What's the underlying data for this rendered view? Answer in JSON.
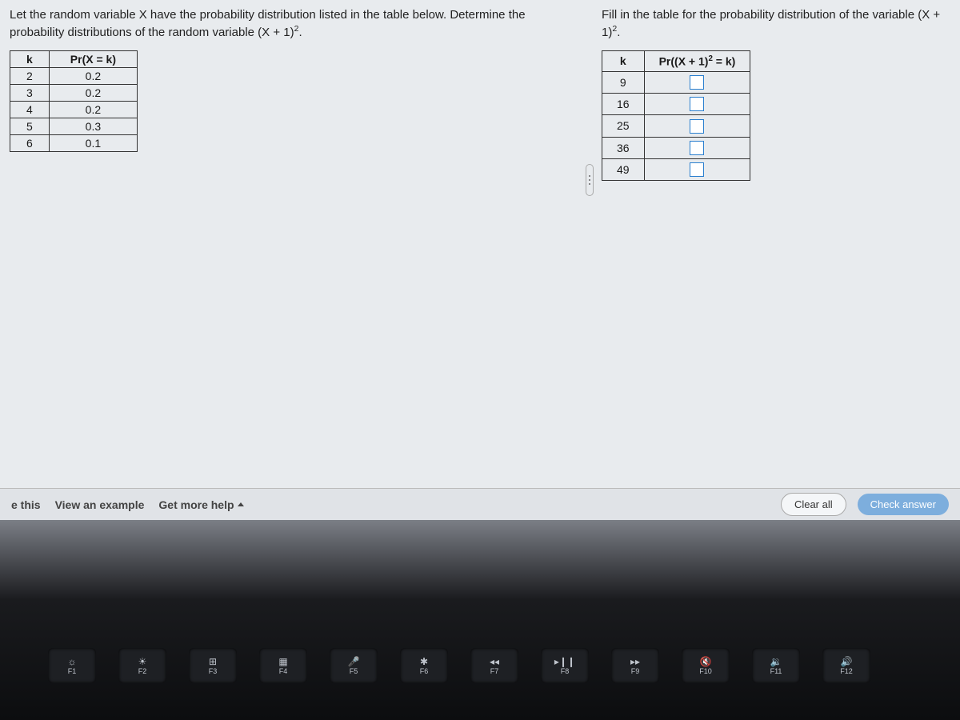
{
  "left": {
    "prompt_line1": "Let the random variable X have the probability distribution listed in the table below. Determine the",
    "prompt_line2_a": "probability distributions of the random variable (X + 1)",
    "prompt_line2_exp": "2",
    "prompt_line2_b": ".",
    "table": {
      "head_k": "k",
      "head_p": "Pr(X = k)",
      "rows": [
        {
          "k": "2",
          "p": "0.2"
        },
        {
          "k": "3",
          "p": "0.2"
        },
        {
          "k": "4",
          "p": "0.2"
        },
        {
          "k": "5",
          "p": "0.3"
        },
        {
          "k": "6",
          "p": "0.1"
        }
      ]
    }
  },
  "right": {
    "prompt_a": "Fill in the table for the probability distribution of the variable (X + 1)",
    "prompt_exp": "2",
    "prompt_b": ".",
    "table": {
      "head_k": "k",
      "head_p_a": "Pr((X + 1)",
      "head_p_exp": "2",
      "head_p_b": " = k)",
      "rows": [
        {
          "k": "9"
        },
        {
          "k": "16"
        },
        {
          "k": "25"
        },
        {
          "k": "36"
        },
        {
          "k": "49"
        }
      ]
    }
  },
  "bottom": {
    "e_this": "e this",
    "view_example": "View an example",
    "get_help": "Get more help",
    "clear": "Clear all",
    "check": "Check answer"
  },
  "keys": [
    "F1",
    "F2",
    "F3",
    "F4",
    "F5",
    "F6",
    "F7",
    "F8",
    "F9",
    "F10",
    "F11",
    "F12"
  ]
}
